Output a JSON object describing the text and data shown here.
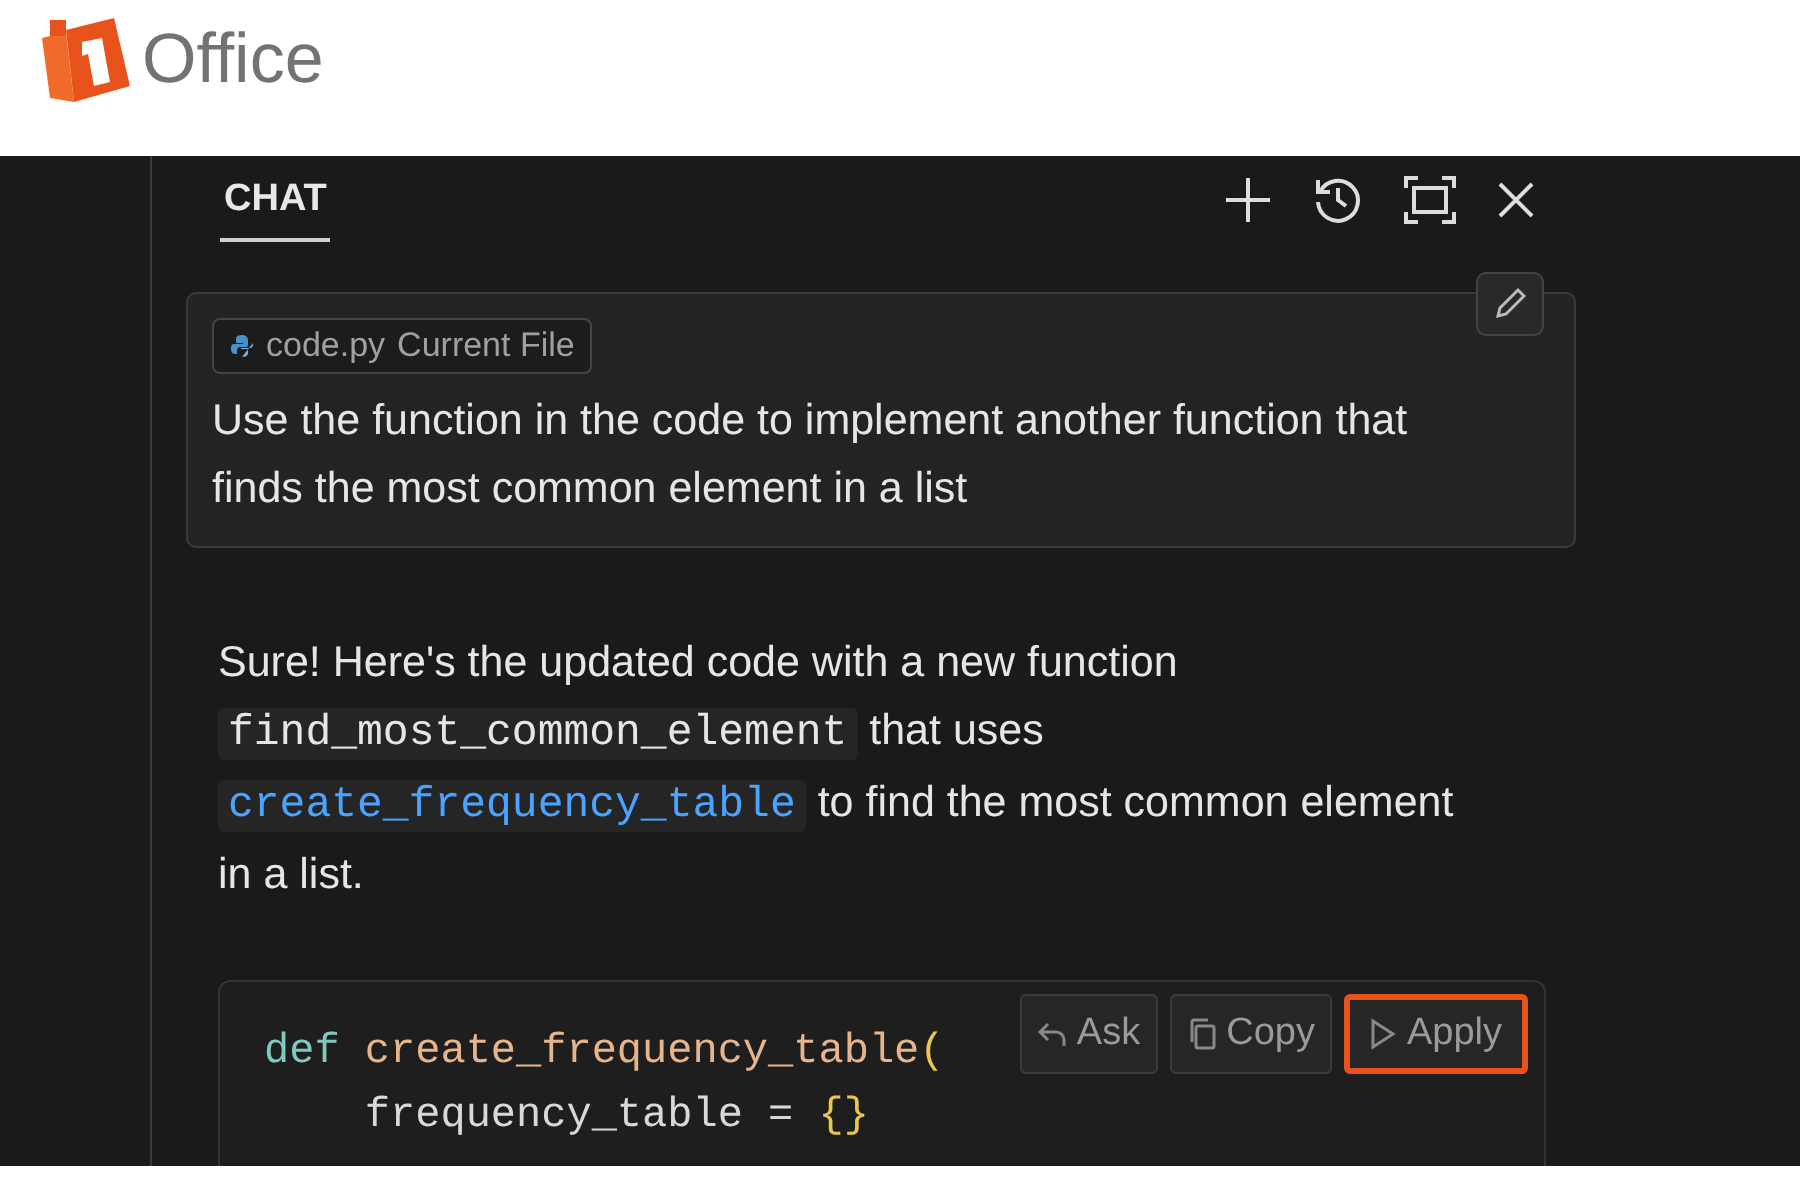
{
  "logo": {
    "text": "Office"
  },
  "chat": {
    "tabs": [
      {
        "label": "CHAT",
        "selected": true
      }
    ],
    "user_message": {
      "file_chip": {
        "name": "code.py",
        "note": "Current File"
      },
      "text": "Use the function in the code to implement another function that finds the most common element in a list"
    },
    "reply": {
      "segments": [
        {
          "kind": "text",
          "text": "Sure! Here's the updated code with a new function "
        },
        {
          "kind": "code",
          "text": "find_most_common_element"
        },
        {
          "kind": "text",
          "text": " that uses "
        },
        {
          "kind": "link",
          "text": "create_frequency_table"
        },
        {
          "kind": "text",
          "text": " to find the most common element in a list."
        }
      ]
    },
    "code_block": {
      "lines": [
        [
          {
            "kind": "keyword",
            "text": "def"
          },
          {
            "kind": "function",
            "text": "create_frequency_table"
          },
          {
            "kind": "paren",
            "text": "("
          }
        ],
        [
          {
            "kind": "plain",
            "text": "    frequency_table = "
          },
          {
            "kind": "brace",
            "text": "{}"
          }
        ]
      ],
      "buttons": [
        {
          "kind": "ask",
          "label": "Ask",
          "highlighted": false
        },
        {
          "kind": "copy",
          "label": "Copy",
          "highlighted": false
        },
        {
          "kind": "apply",
          "label": "Apply",
          "highlighted": true
        }
      ]
    }
  }
}
